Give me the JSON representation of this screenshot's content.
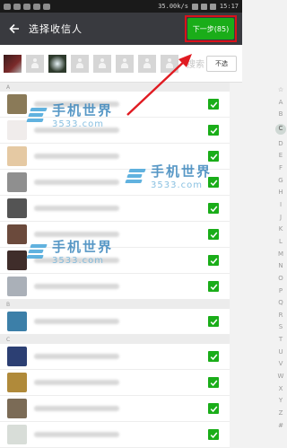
{
  "status_bar": {
    "speed": "35.00k/s",
    "time": "15:17"
  },
  "top_bar": {
    "title": "选择收信人",
    "next_label": "下一步(85)"
  },
  "selected_strip": {
    "search_text": "搜索",
    "cancel_label": "不选"
  },
  "sections": [
    {
      "letter": "A",
      "rows": [
        {
          "avatar_color": "#8a7a58"
        },
        {
          "avatar_color": "#f0eceb"
        },
        {
          "avatar_color": "#e5c9a3"
        },
        {
          "avatar_color": "#8f8f8f"
        },
        {
          "avatar_color": "#545454"
        },
        {
          "avatar_color": "#6b4a3c"
        },
        {
          "avatar_color": "#3f2d2a"
        },
        {
          "avatar_color": "#aab0b8"
        }
      ]
    },
    {
      "letter": "B",
      "rows": [
        {
          "avatar_color": "#3c7fa8"
        }
      ]
    },
    {
      "letter": "C",
      "rows": [
        {
          "avatar_color": "#2c3f73"
        },
        {
          "avatar_color": "#b08a3a"
        },
        {
          "avatar_color": "#7b6b56"
        },
        {
          "avatar_color": "#d8ddd8"
        }
      ]
    }
  ],
  "alpha_index": [
    "☆",
    "A",
    "B",
    "C",
    "D",
    "E",
    "F",
    "G",
    "H",
    "I",
    "J",
    "K",
    "L",
    "M",
    "N",
    "O",
    "P",
    "Q",
    "R",
    "S",
    "T",
    "U",
    "V",
    "W",
    "X",
    "Y",
    "Z",
    "#"
  ],
  "alpha_active": "C",
  "watermark": {
    "text": "手机世界",
    "number": "3533.com"
  },
  "colors": {
    "toolbar": "#393a3f",
    "accent_green": "#1aad19",
    "highlight_red": "#d9121a"
  }
}
